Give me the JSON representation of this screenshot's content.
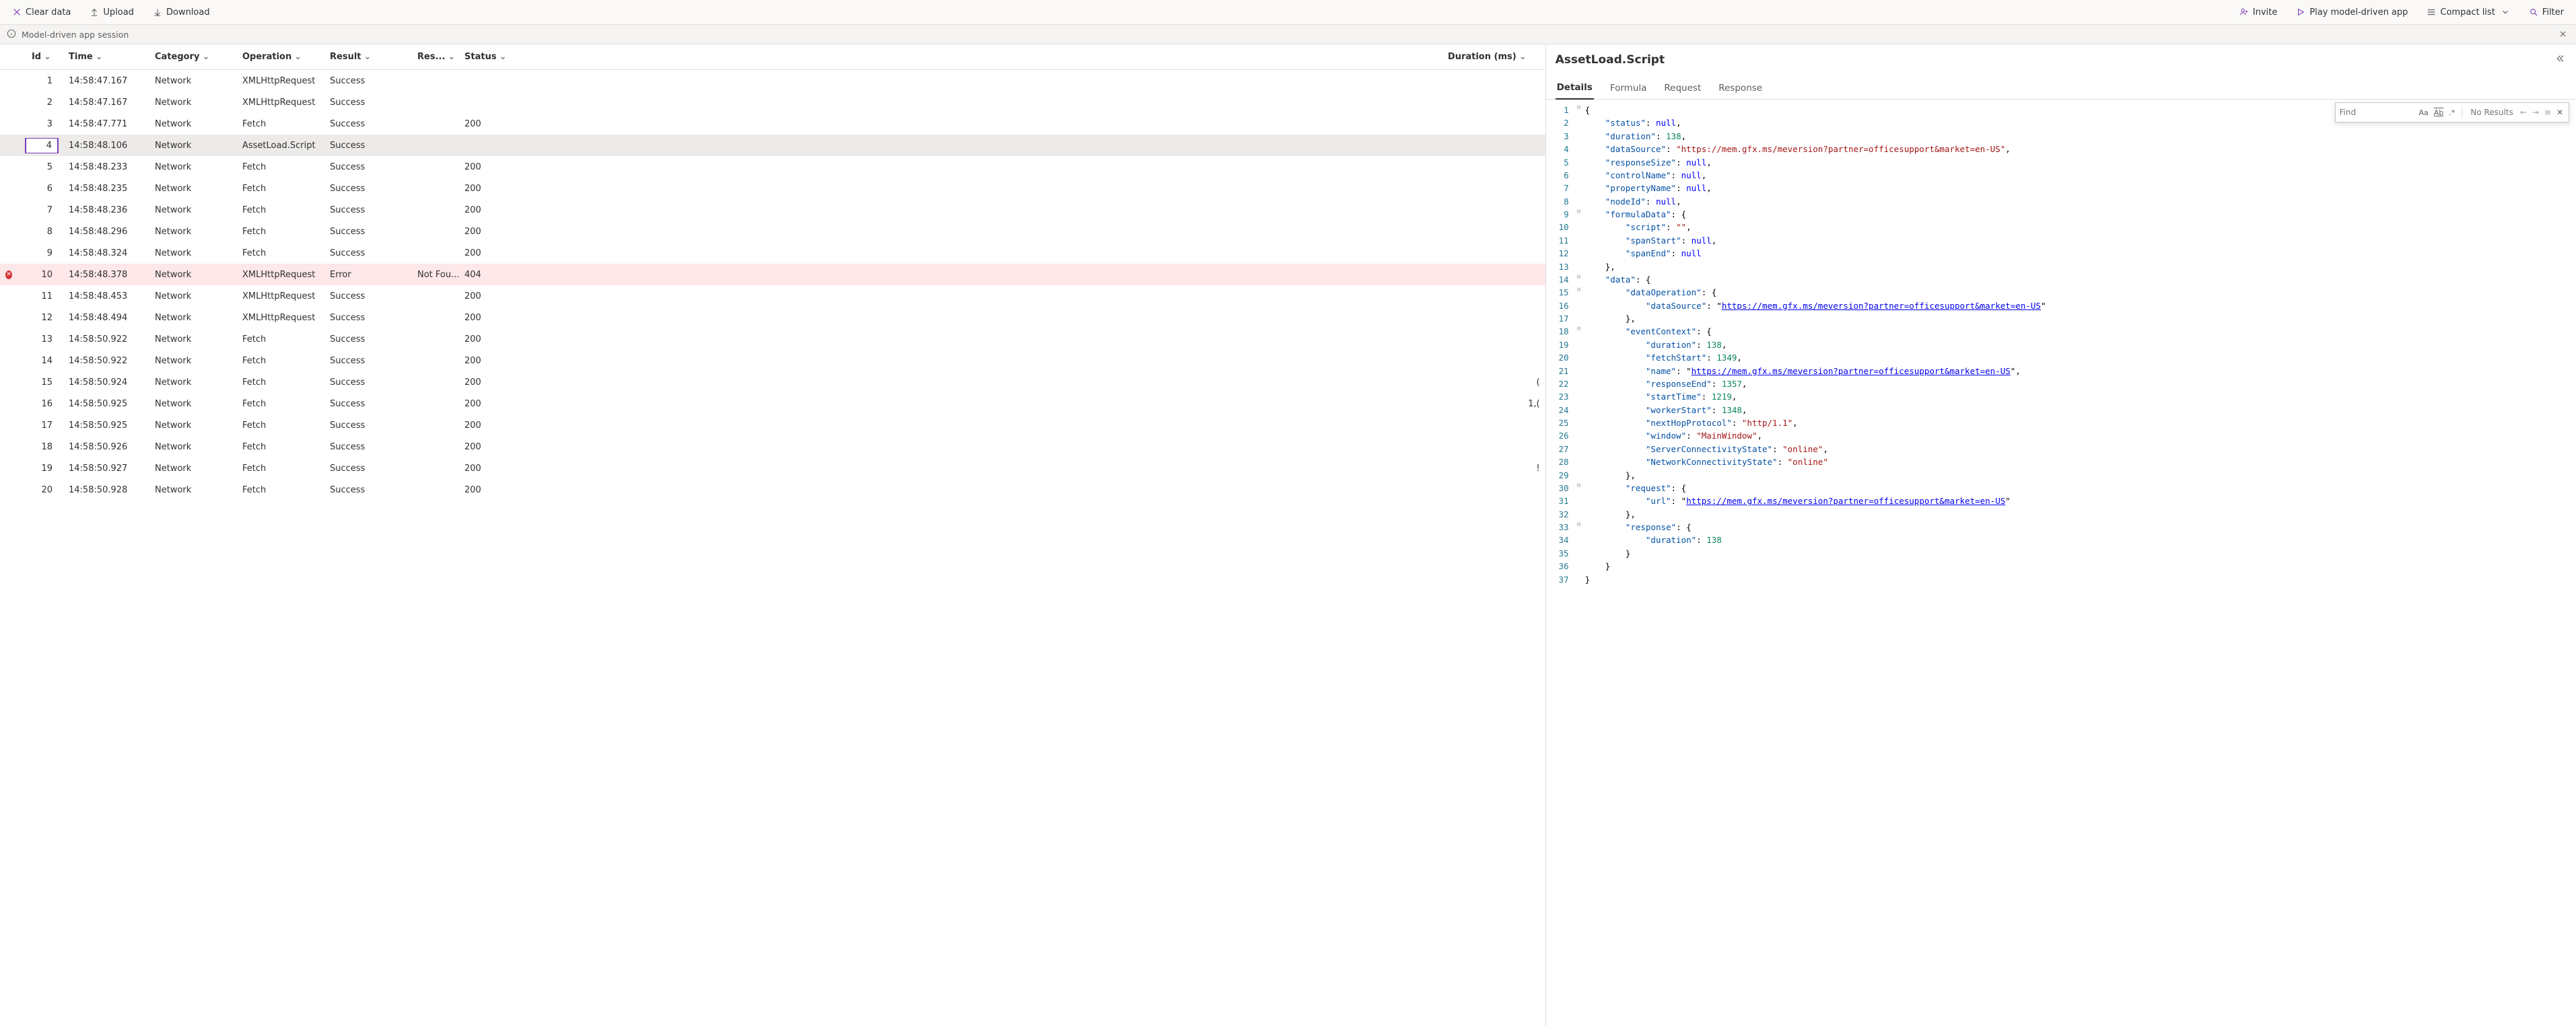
{
  "toolbar": {
    "clear": "Clear data",
    "upload": "Upload",
    "download": "Download",
    "invite": "Invite",
    "play": "Play model-driven app",
    "compact": "Compact list",
    "filter": "Filter"
  },
  "session": {
    "title": "Model-driven app session"
  },
  "table": {
    "columns": {
      "id": "Id",
      "time": "Time",
      "category": "Category",
      "operation": "Operation",
      "result": "Result",
      "res2": "Res...",
      "status": "Status",
      "duration": "Duration (ms)"
    },
    "rows": [
      {
        "id": 1,
        "time": "14:58:47.167",
        "cat": "Network",
        "op": "XMLHttpRequest",
        "res": "Success",
        "res2": "",
        "status": "",
        "dur": "",
        "err": false
      },
      {
        "id": 2,
        "time": "14:58:47.167",
        "cat": "Network",
        "op": "XMLHttpRequest",
        "res": "Success",
        "res2": "",
        "status": "",
        "dur": "",
        "err": false
      },
      {
        "id": 3,
        "time": "14:58:47.771",
        "cat": "Network",
        "op": "Fetch",
        "res": "Success",
        "res2": "",
        "status": "200",
        "dur": "",
        "err": false
      },
      {
        "id": 4,
        "time": "14:58:48.106",
        "cat": "Network",
        "op": "AssetLoad.Script",
        "res": "Success",
        "res2": "",
        "status": "",
        "dur": "",
        "err": false,
        "selected": true
      },
      {
        "id": 5,
        "time": "14:58:48.233",
        "cat": "Network",
        "op": "Fetch",
        "res": "Success",
        "res2": "",
        "status": "200",
        "dur": "",
        "err": false
      },
      {
        "id": 6,
        "time": "14:58:48.235",
        "cat": "Network",
        "op": "Fetch",
        "res": "Success",
        "res2": "",
        "status": "200",
        "dur": "",
        "err": false
      },
      {
        "id": 7,
        "time": "14:58:48.236",
        "cat": "Network",
        "op": "Fetch",
        "res": "Success",
        "res2": "",
        "status": "200",
        "dur": "",
        "err": false
      },
      {
        "id": 8,
        "time": "14:58:48.296",
        "cat": "Network",
        "op": "Fetch",
        "res": "Success",
        "res2": "",
        "status": "200",
        "dur": "",
        "err": false
      },
      {
        "id": 9,
        "time": "14:58:48.324",
        "cat": "Network",
        "op": "Fetch",
        "res": "Success",
        "res2": "",
        "status": "200",
        "dur": "",
        "err": false
      },
      {
        "id": 10,
        "time": "14:58:48.378",
        "cat": "Network",
        "op": "XMLHttpRequest",
        "res": "Error",
        "res2": "Not Fou...",
        "status": "404",
        "dur": "",
        "err": true
      },
      {
        "id": 11,
        "time": "14:58:48.453",
        "cat": "Network",
        "op": "XMLHttpRequest",
        "res": "Success",
        "res2": "",
        "status": "200",
        "dur": "",
        "err": false
      },
      {
        "id": 12,
        "time": "14:58:48.494",
        "cat": "Network",
        "op": "XMLHttpRequest",
        "res": "Success",
        "res2": "",
        "status": "200",
        "dur": "",
        "err": false
      },
      {
        "id": 13,
        "time": "14:58:50.922",
        "cat": "Network",
        "op": "Fetch",
        "res": "Success",
        "res2": "",
        "status": "200",
        "dur": "",
        "err": false
      },
      {
        "id": 14,
        "time": "14:58:50.922",
        "cat": "Network",
        "op": "Fetch",
        "res": "Success",
        "res2": "",
        "status": "200",
        "dur": "",
        "err": false
      },
      {
        "id": 15,
        "time": "14:58:50.924",
        "cat": "Network",
        "op": "Fetch",
        "res": "Success",
        "res2": "",
        "status": "200",
        "dur": "(",
        "err": false
      },
      {
        "id": 16,
        "time": "14:58:50.925",
        "cat": "Network",
        "op": "Fetch",
        "res": "Success",
        "res2": "",
        "status": "200",
        "dur": "1,(",
        "err": false
      },
      {
        "id": 17,
        "time": "14:58:50.925",
        "cat": "Network",
        "op": "Fetch",
        "res": "Success",
        "res2": "",
        "status": "200",
        "dur": "",
        "err": false
      },
      {
        "id": 18,
        "time": "14:58:50.926",
        "cat": "Network",
        "op": "Fetch",
        "res": "Success",
        "res2": "",
        "status": "200",
        "dur": "",
        "err": false
      },
      {
        "id": 19,
        "time": "14:58:50.927",
        "cat": "Network",
        "op": "Fetch",
        "res": "Success",
        "res2": "",
        "status": "200",
        "dur": "!",
        "err": false
      },
      {
        "id": 20,
        "time": "14:58:50.928",
        "cat": "Network",
        "op": "Fetch",
        "res": "Success",
        "res2": "",
        "status": "200",
        "dur": "",
        "err": false
      }
    ]
  },
  "panel": {
    "title": "AssetLoad.Script",
    "tabs": {
      "details": "Details",
      "formula": "Formula",
      "request": "Request",
      "response": "Response"
    },
    "find": {
      "placeholder": "Find",
      "status": "No Results"
    },
    "json_lines": [
      {
        "n": 1,
        "fold": "⊟",
        "indent": 0,
        "tokens": [
          {
            "t": "punc",
            "v": "{"
          }
        ]
      },
      {
        "n": 2,
        "fold": "",
        "indent": 2,
        "tokens": [
          {
            "t": "key",
            "v": "\"status\""
          },
          {
            "t": "punc",
            "v": ": "
          },
          {
            "t": "null",
            "v": "null"
          },
          {
            "t": "punc",
            "v": ","
          }
        ]
      },
      {
        "n": 3,
        "fold": "",
        "indent": 2,
        "tokens": [
          {
            "t": "key",
            "v": "\"duration\""
          },
          {
            "t": "punc",
            "v": ": "
          },
          {
            "t": "num",
            "v": "138"
          },
          {
            "t": "punc",
            "v": ","
          }
        ]
      },
      {
        "n": 4,
        "fold": "",
        "indent": 2,
        "tokens": [
          {
            "t": "key",
            "v": "\"dataSource\""
          },
          {
            "t": "punc",
            "v": ": "
          },
          {
            "t": "str",
            "v": "\"https://mem.gfx.ms/meversion?partner=officesupport&market=en-US\""
          },
          {
            "t": "punc",
            "v": ","
          }
        ]
      },
      {
        "n": 5,
        "fold": "",
        "indent": 2,
        "tokens": [
          {
            "t": "key",
            "v": "\"responseSize\""
          },
          {
            "t": "punc",
            "v": ": "
          },
          {
            "t": "null",
            "v": "null"
          },
          {
            "t": "punc",
            "v": ","
          }
        ]
      },
      {
        "n": 6,
        "fold": "",
        "indent": 2,
        "tokens": [
          {
            "t": "key",
            "v": "\"controlName\""
          },
          {
            "t": "punc",
            "v": ": "
          },
          {
            "t": "null",
            "v": "null"
          },
          {
            "t": "punc",
            "v": ","
          }
        ]
      },
      {
        "n": 7,
        "fold": "",
        "indent": 2,
        "tokens": [
          {
            "t": "key",
            "v": "\"propertyName\""
          },
          {
            "t": "punc",
            "v": ": "
          },
          {
            "t": "null",
            "v": "null"
          },
          {
            "t": "punc",
            "v": ","
          }
        ]
      },
      {
        "n": 8,
        "fold": "",
        "indent": 2,
        "tokens": [
          {
            "t": "key",
            "v": "\"nodeId\""
          },
          {
            "t": "punc",
            "v": ": "
          },
          {
            "t": "null",
            "v": "null"
          },
          {
            "t": "punc",
            "v": ","
          }
        ]
      },
      {
        "n": 9,
        "fold": "⊟",
        "indent": 2,
        "tokens": [
          {
            "t": "key",
            "v": "\"formulaData\""
          },
          {
            "t": "punc",
            "v": ": {"
          }
        ]
      },
      {
        "n": 10,
        "fold": "",
        "indent": 4,
        "tokens": [
          {
            "t": "key",
            "v": "\"script\""
          },
          {
            "t": "punc",
            "v": ": "
          },
          {
            "t": "str",
            "v": "\"\""
          },
          {
            "t": "punc",
            "v": ","
          }
        ]
      },
      {
        "n": 11,
        "fold": "",
        "indent": 4,
        "tokens": [
          {
            "t": "key",
            "v": "\"spanStart\""
          },
          {
            "t": "punc",
            "v": ": "
          },
          {
            "t": "null",
            "v": "null"
          },
          {
            "t": "punc",
            "v": ","
          }
        ]
      },
      {
        "n": 12,
        "fold": "",
        "indent": 4,
        "tokens": [
          {
            "t": "key",
            "v": "\"spanEnd\""
          },
          {
            "t": "punc",
            "v": ": "
          },
          {
            "t": "null",
            "v": "null"
          }
        ]
      },
      {
        "n": 13,
        "fold": "",
        "indent": 2,
        "tokens": [
          {
            "t": "punc",
            "v": "},"
          }
        ]
      },
      {
        "n": 14,
        "fold": "⊟",
        "indent": 2,
        "tokens": [
          {
            "t": "key",
            "v": "\"data\""
          },
          {
            "t": "punc",
            "v": ": {"
          }
        ]
      },
      {
        "n": 15,
        "fold": "⊟",
        "indent": 4,
        "tokens": [
          {
            "t": "key",
            "v": "\"dataOperation\""
          },
          {
            "t": "punc",
            "v": ": {"
          }
        ]
      },
      {
        "n": 16,
        "fold": "",
        "indent": 6,
        "tokens": [
          {
            "t": "key",
            "v": "\"dataSource\""
          },
          {
            "t": "punc",
            "v": ": "
          },
          {
            "t": "punc",
            "v": "\""
          },
          {
            "t": "url",
            "v": "https://mem.gfx.ms/meversion?partner=officesupport&market=en-US"
          },
          {
            "t": "punc",
            "v": "\""
          }
        ]
      },
      {
        "n": 17,
        "fold": "",
        "indent": 4,
        "tokens": [
          {
            "t": "punc",
            "v": "},"
          }
        ]
      },
      {
        "n": 18,
        "fold": "⊟",
        "indent": 4,
        "tokens": [
          {
            "t": "key",
            "v": "\"eventContext\""
          },
          {
            "t": "punc",
            "v": ": {"
          }
        ]
      },
      {
        "n": 19,
        "fold": "",
        "indent": 6,
        "tokens": [
          {
            "t": "key",
            "v": "\"duration\""
          },
          {
            "t": "punc",
            "v": ": "
          },
          {
            "t": "num",
            "v": "138"
          },
          {
            "t": "punc",
            "v": ","
          }
        ]
      },
      {
        "n": 20,
        "fold": "",
        "indent": 6,
        "tokens": [
          {
            "t": "key",
            "v": "\"fetchStart\""
          },
          {
            "t": "punc",
            "v": ": "
          },
          {
            "t": "num",
            "v": "1349"
          },
          {
            "t": "punc",
            "v": ","
          }
        ]
      },
      {
        "n": 21,
        "fold": "",
        "indent": 6,
        "tokens": [
          {
            "t": "key",
            "v": "\"name\""
          },
          {
            "t": "punc",
            "v": ": "
          },
          {
            "t": "punc",
            "v": "\""
          },
          {
            "t": "url",
            "v": "https://mem.gfx.ms/meversion?partner=officesupport&market=en-US"
          },
          {
            "t": "punc",
            "v": "\","
          }
        ]
      },
      {
        "n": 22,
        "fold": "",
        "indent": 6,
        "tokens": [
          {
            "t": "key",
            "v": "\"responseEnd\""
          },
          {
            "t": "punc",
            "v": ": "
          },
          {
            "t": "num",
            "v": "1357"
          },
          {
            "t": "punc",
            "v": ","
          }
        ]
      },
      {
        "n": 23,
        "fold": "",
        "indent": 6,
        "tokens": [
          {
            "t": "key",
            "v": "\"startTime\""
          },
          {
            "t": "punc",
            "v": ": "
          },
          {
            "t": "num",
            "v": "1219"
          },
          {
            "t": "punc",
            "v": ","
          }
        ]
      },
      {
        "n": 24,
        "fold": "",
        "indent": 6,
        "tokens": [
          {
            "t": "key",
            "v": "\"workerStart\""
          },
          {
            "t": "punc",
            "v": ": "
          },
          {
            "t": "num",
            "v": "1348"
          },
          {
            "t": "punc",
            "v": ","
          }
        ]
      },
      {
        "n": 25,
        "fold": "",
        "indent": 6,
        "tokens": [
          {
            "t": "key",
            "v": "\"nextHopProtocol\""
          },
          {
            "t": "punc",
            "v": ": "
          },
          {
            "t": "str",
            "v": "\"http/1.1\""
          },
          {
            "t": "punc",
            "v": ","
          }
        ]
      },
      {
        "n": 26,
        "fold": "",
        "indent": 6,
        "tokens": [
          {
            "t": "key",
            "v": "\"window\""
          },
          {
            "t": "punc",
            "v": ": "
          },
          {
            "t": "str",
            "v": "\"MainWindow\""
          },
          {
            "t": "punc",
            "v": ","
          }
        ]
      },
      {
        "n": 27,
        "fold": "",
        "indent": 6,
        "tokens": [
          {
            "t": "key",
            "v": "\"ServerConnectivityState\""
          },
          {
            "t": "punc",
            "v": ": "
          },
          {
            "t": "str",
            "v": "\"online\""
          },
          {
            "t": "punc",
            "v": ","
          }
        ]
      },
      {
        "n": 28,
        "fold": "",
        "indent": 6,
        "tokens": [
          {
            "t": "key",
            "v": "\"NetworkConnectivityState\""
          },
          {
            "t": "punc",
            "v": ": "
          },
          {
            "t": "str",
            "v": "\"online\""
          }
        ]
      },
      {
        "n": 29,
        "fold": "",
        "indent": 4,
        "tokens": [
          {
            "t": "punc",
            "v": "},"
          }
        ]
      },
      {
        "n": 30,
        "fold": "⊟",
        "indent": 4,
        "tokens": [
          {
            "t": "key",
            "v": "\"request\""
          },
          {
            "t": "punc",
            "v": ": {"
          }
        ]
      },
      {
        "n": 31,
        "fold": "",
        "indent": 6,
        "tokens": [
          {
            "t": "key",
            "v": "\"url\""
          },
          {
            "t": "punc",
            "v": ": "
          },
          {
            "t": "punc",
            "v": "\""
          },
          {
            "t": "url",
            "v": "https://mem.gfx.ms/meversion?partner=officesupport&market=en-US"
          },
          {
            "t": "punc",
            "v": "\""
          }
        ]
      },
      {
        "n": 32,
        "fold": "",
        "indent": 4,
        "tokens": [
          {
            "t": "punc",
            "v": "},"
          }
        ]
      },
      {
        "n": 33,
        "fold": "⊟",
        "indent": 4,
        "tokens": [
          {
            "t": "key",
            "v": "\"response\""
          },
          {
            "t": "punc",
            "v": ": {"
          }
        ]
      },
      {
        "n": 34,
        "fold": "",
        "indent": 6,
        "tokens": [
          {
            "t": "key",
            "v": "\"duration\""
          },
          {
            "t": "punc",
            "v": ": "
          },
          {
            "t": "num",
            "v": "138"
          }
        ]
      },
      {
        "n": 35,
        "fold": "",
        "indent": 4,
        "tokens": [
          {
            "t": "punc",
            "v": "}"
          }
        ]
      },
      {
        "n": 36,
        "fold": "",
        "indent": 2,
        "tokens": [
          {
            "t": "punc",
            "v": "}"
          }
        ]
      },
      {
        "n": 37,
        "fold": "",
        "indent": 0,
        "tokens": [
          {
            "t": "punc",
            "v": "}"
          }
        ]
      }
    ]
  }
}
